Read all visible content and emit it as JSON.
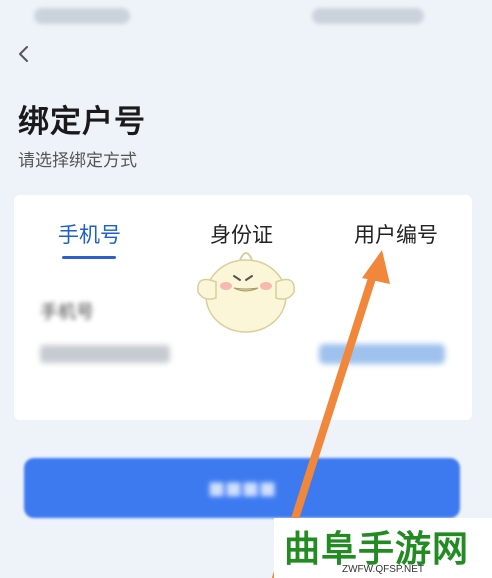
{
  "header": {
    "title": "绑定户号",
    "subtitle": "请选择绑定方式"
  },
  "tabs": [
    {
      "label": "手机号",
      "active": true
    },
    {
      "label": "身份证",
      "active": false
    },
    {
      "label": "用户编号",
      "active": false
    }
  ],
  "form": {
    "label": "手机号"
  },
  "watermark": {
    "title": "曲阜手游网",
    "url": "ZWFW.QFSP.NET"
  },
  "colors": {
    "accent": "#2a62c9",
    "button": "#3d7af0",
    "arrow": "#f0873a",
    "watermark": "#228b22"
  },
  "icons": [
    "back-chevron-icon",
    "mascot-illustration",
    "arrow-annotation"
  ]
}
